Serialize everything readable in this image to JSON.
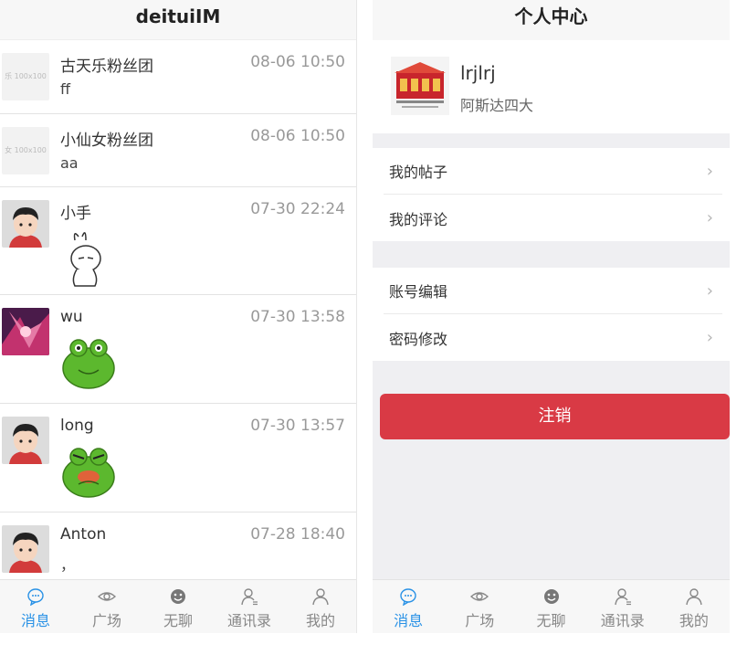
{
  "left": {
    "title": "deituiIM",
    "messages": [
      {
        "name": "古天乐粉丝团",
        "time": "08-06 10:50",
        "preview": "ff",
        "avatar_text": "乐 100x100"
      },
      {
        "name": "小仙女粉丝团",
        "time": "08-06 10:50",
        "preview": "aa",
        "avatar_text": "女 100x100"
      },
      {
        "name": "小手",
        "time": "07-30 22:24",
        "preview": "",
        "sticker": "rabbit-sticker"
      },
      {
        "name": "wu",
        "time": "07-30 13:58",
        "preview": "",
        "sticker": "frog-sticker"
      },
      {
        "name": "long",
        "time": "07-30 13:57",
        "preview": "",
        "sticker": "angry-frog-sticker"
      },
      {
        "name": "Anton",
        "time": "07-28 18:40",
        "preview": "，"
      }
    ]
  },
  "tabs": [
    {
      "label": "消息",
      "icon": "message-icon",
      "active": true
    },
    {
      "label": "广场",
      "icon": "eye-icon",
      "active": false
    },
    {
      "label": "无聊",
      "icon": "smiley-icon",
      "active": false
    },
    {
      "label": "通讯录",
      "icon": "contacts-icon",
      "active": false
    },
    {
      "label": "我的",
      "icon": "user-icon",
      "active": false
    }
  ],
  "right": {
    "title": "个人中心",
    "username": "lrjlrj",
    "subtitle": "阿斯达四大",
    "menu_group_1": [
      "我的帖子",
      "我的评论"
    ],
    "menu_group_2": [
      "账号编辑",
      "密码修改"
    ],
    "logout_label": "注销"
  },
  "colors": {
    "accent": "#2a92e6",
    "danger": "#d93a45",
    "background": "#efeff2"
  }
}
